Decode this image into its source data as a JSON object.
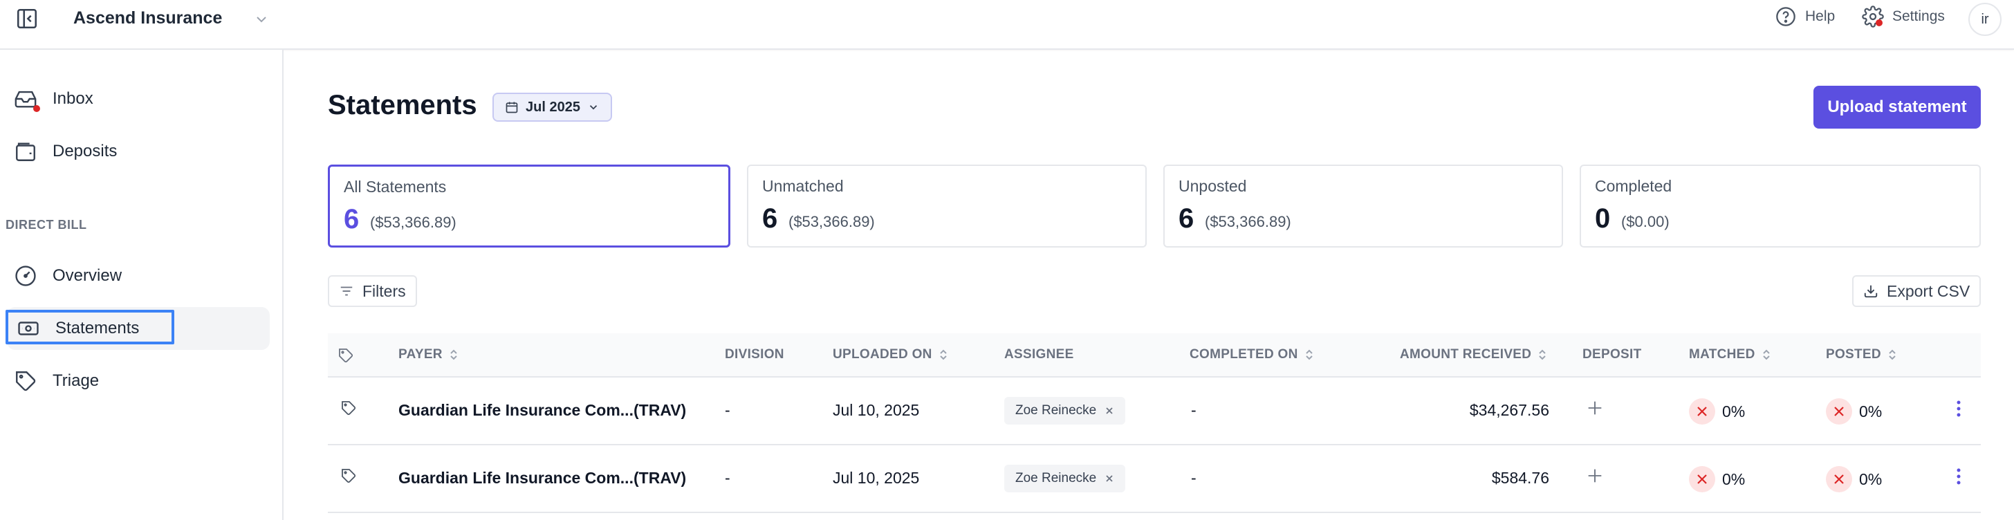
{
  "topbar": {
    "org_name": "Ascend Insurance",
    "help_label": "Help",
    "settings_label": "Settings",
    "avatar_initials": "ir"
  },
  "sidebar": {
    "items": [
      {
        "label": "Inbox",
        "icon": "inbox-icon"
      },
      {
        "label": "Deposits",
        "icon": "wallet-icon"
      }
    ],
    "section_label": "DIRECT BILL",
    "section_items": [
      {
        "label": "Overview",
        "icon": "gauge-icon"
      },
      {
        "label": "Statements",
        "icon": "banknote-icon",
        "active": true
      },
      {
        "label": "Triage",
        "icon": "tag-icon"
      }
    ]
  },
  "page": {
    "title": "Statements",
    "date_filter": "Jul 2025",
    "upload_label": "Upload statement",
    "filters_label": "Filters",
    "export_label": "Export CSV"
  },
  "cards": [
    {
      "label": "All Statements",
      "count": "6",
      "amount": "($53,366.89)",
      "active": true
    },
    {
      "label": "Unmatched",
      "count": "6",
      "amount": "($53,366.89)"
    },
    {
      "label": "Unposted",
      "count": "6",
      "amount": "($53,366.89)"
    },
    {
      "label": "Completed",
      "count": "0",
      "amount": "($0.00)"
    }
  ],
  "table": {
    "headers": {
      "payer": "PAYER",
      "division": "DIVISION",
      "uploaded_on": "UPLOADED ON",
      "assignee": "ASSIGNEE",
      "completed_on": "COMPLETED ON",
      "amount_received": "AMOUNT RECEIVED",
      "deposit": "DEPOSIT",
      "matched": "MATCHED",
      "posted": "POSTED"
    },
    "rows": [
      {
        "payer": "Guardian Life Insurance Com...",
        "payer_code": "(TRAV)",
        "division": "-",
        "uploaded_on": "Jul 10, 2025",
        "assignee": "Zoe Reinecke",
        "completed_on": "-",
        "amount": "$34,267.56",
        "matched": "0%",
        "posted": "0%"
      },
      {
        "payer": "Guardian Life Insurance Com...",
        "payer_code": "(TRAV)",
        "division": "-",
        "uploaded_on": "Jul 10, 2025",
        "assignee": "Zoe Reinecke",
        "completed_on": "-",
        "amount": "$584.76",
        "matched": "0%",
        "posted": "0%"
      }
    ]
  },
  "colors": {
    "accent": "#5b4fe0",
    "danger_dot": "#dc2626",
    "highlight": "#3b82f6"
  }
}
